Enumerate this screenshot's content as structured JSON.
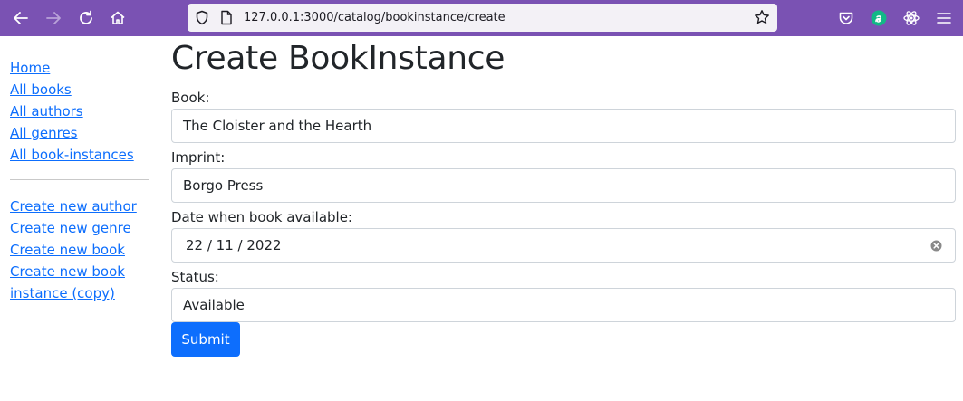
{
  "browser": {
    "url": "127.0.0.1:3000/catalog/bookinstance/create",
    "colors": {
      "toolbar": "#7a52b3",
      "urlbar": "#f3f1f6"
    }
  },
  "sidebar": {
    "primary_links": [
      {
        "label": "Home"
      },
      {
        "label": "All books"
      },
      {
        "label": "All authors"
      },
      {
        "label": "All genres"
      },
      {
        "label": "All book-instances"
      }
    ],
    "secondary_links": [
      {
        "label": "Create new author"
      },
      {
        "label": "Create new genre"
      },
      {
        "label": "Create new book"
      },
      {
        "label": "Create new book"
      },
      {
        "label": "instance (copy)"
      }
    ]
  },
  "form": {
    "title": "Create BookInstance",
    "fields": [
      {
        "label": "Book:",
        "value": "The Cloister and the Hearth"
      },
      {
        "label": "Imprint:",
        "value": "Borgo Press"
      },
      {
        "label": "Date when book available:",
        "value": "22 / 11 / 2022"
      },
      {
        "label": "Status:",
        "value": "Available"
      }
    ],
    "submit_label": "Submit",
    "colors": {
      "link": "#0d6efd",
      "button": "#0d6efd"
    }
  }
}
